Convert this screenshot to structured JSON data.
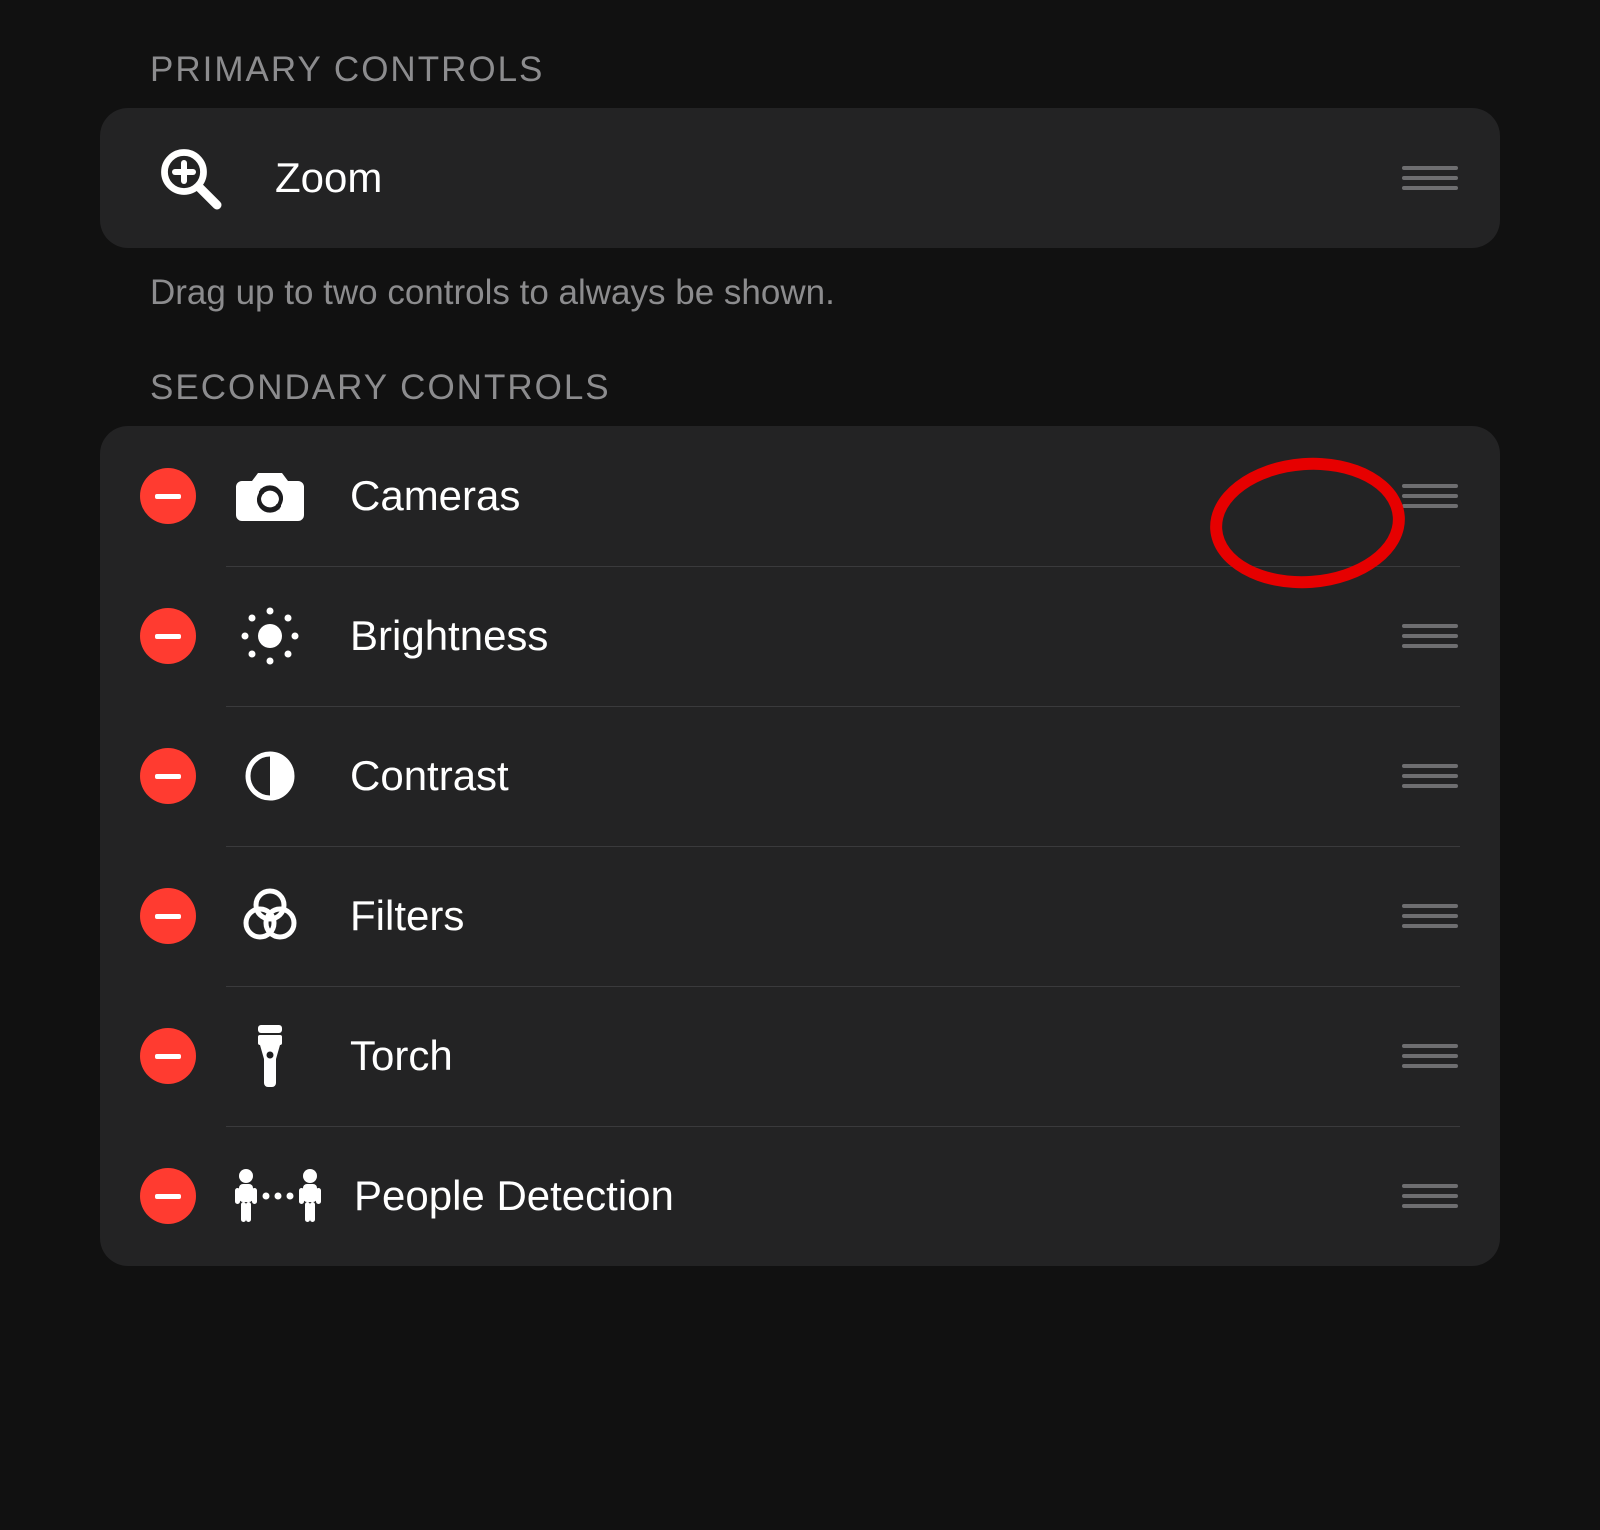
{
  "primary": {
    "header": "PRIMARY CONTROLS",
    "items": [
      {
        "icon": "zoom-in-icon",
        "label": "Zoom"
      }
    ],
    "hint": "Drag up to two controls to always be shown."
  },
  "secondary": {
    "header": "SECONDARY CONTROLS",
    "items": [
      {
        "icon": "camera-switch-icon",
        "label": "Cameras"
      },
      {
        "icon": "brightness-icon",
        "label": "Brightness"
      },
      {
        "icon": "contrast-icon",
        "label": "Contrast"
      },
      {
        "icon": "filters-icon",
        "label": "Filters"
      },
      {
        "icon": "torch-icon",
        "label": "Torch"
      },
      {
        "icon": "people-detection-icon",
        "label": "People Detection"
      }
    ]
  },
  "annotation": {
    "highlight_row_index": 0
  },
  "colors": {
    "delete_red": "#ff3b30",
    "annotation_red": "#e60000",
    "card_bg": "#232324",
    "screen_bg": "#111111"
  }
}
